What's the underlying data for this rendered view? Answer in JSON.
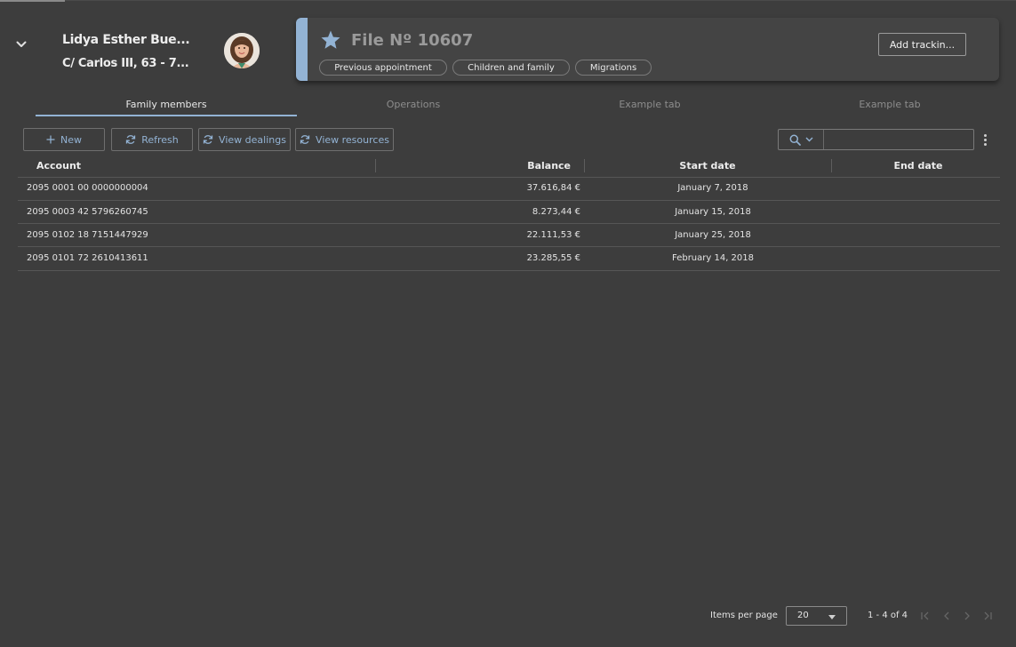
{
  "header": {
    "person_name": "Lidya Esther Bue...",
    "person_address": "C/ Carlos III, 63 - 7...",
    "file_title": "File Nº 10607",
    "chips": [
      "Previous appointment",
      "Children and family",
      "Migrations"
    ],
    "add_tracking_label": "Add trackin...",
    "accent_color": "#93b3d4"
  },
  "tabs": [
    "Family members",
    "Operations",
    "Example tab",
    "Example tab"
  ],
  "toolbar": {
    "new_label": "New",
    "refresh_label": "Refresh",
    "view_dealings_label": "View dealings",
    "view_resources_label": "View resources",
    "search_placeholder": ""
  },
  "table": {
    "columns": [
      "Account",
      "Balance",
      "Start date",
      "End date"
    ],
    "rows": [
      {
        "account": "2095 0001 00 0000000004",
        "balance": "37.616,84 €",
        "start_date": "January 7, 2018",
        "end_date": ""
      },
      {
        "account": "2095 0003 42 5796260745",
        "balance": "8.273,44 €",
        "start_date": "January 15, 2018",
        "end_date": ""
      },
      {
        "account": "2095 0102 18 7151447929",
        "balance": "22.111,53 €",
        "start_date": "January 25, 2018",
        "end_date": ""
      },
      {
        "account": "2095 0101 72 2610413611",
        "balance": "23.285,55 €",
        "start_date": "February 14, 2018",
        "end_date": ""
      }
    ]
  },
  "paginator": {
    "items_per_page_label": "Items per page",
    "page_size": "20",
    "range_label": "1 - 4 of 4"
  }
}
